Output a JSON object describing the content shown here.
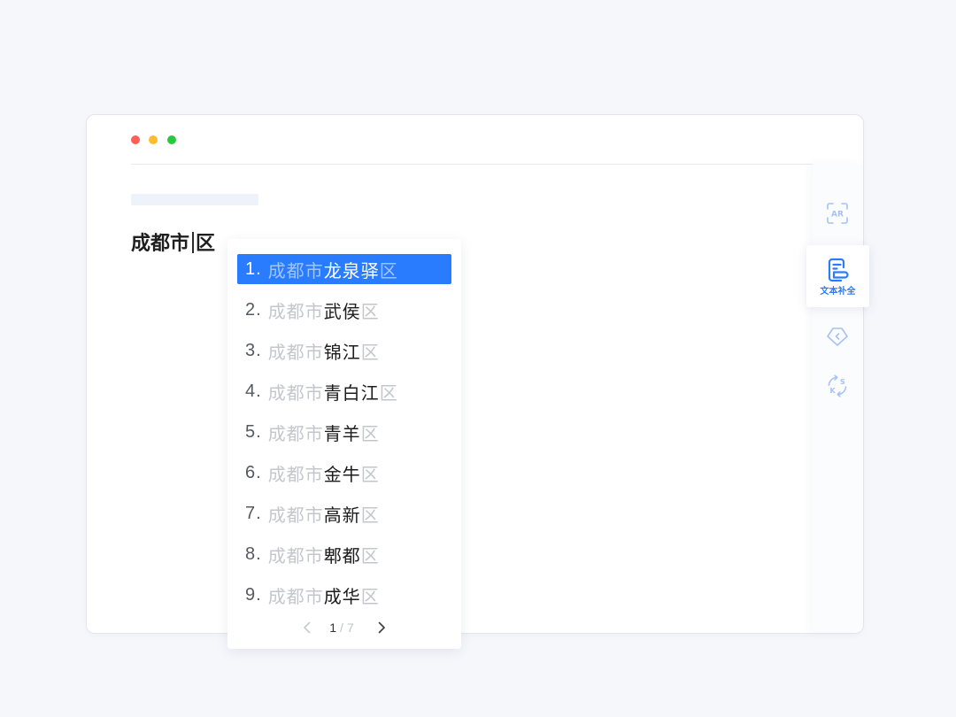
{
  "window": {
    "traffic_lights": {
      "close": "#ff5f57",
      "minimize": "#febc2e",
      "zoom": "#28c840"
    }
  },
  "editor": {
    "text_before_cursor": "成都市",
    "text_after_cursor": "区"
  },
  "suggestions": {
    "items": [
      {
        "index": "1.",
        "prefix": "成都市",
        "name": "龙泉驿",
        "suffix": "区",
        "selected": true
      },
      {
        "index": "2.",
        "prefix": "成都市",
        "name": "武侯",
        "suffix": "区",
        "selected": false
      },
      {
        "index": "3.",
        "prefix": "成都市",
        "name": "锦江",
        "suffix": "区",
        "selected": false
      },
      {
        "index": "4.",
        "prefix": "成都市",
        "name": "青白江",
        "suffix": "区",
        "selected": false
      },
      {
        "index": "5.",
        "prefix": "成都市",
        "name": "青羊",
        "suffix": "区",
        "selected": false
      },
      {
        "index": "6.",
        "prefix": "成都市",
        "name": "金牛",
        "suffix": "区",
        "selected": false
      },
      {
        "index": "7.",
        "prefix": "成都市",
        "name": "高新",
        "suffix": "区",
        "selected": false
      },
      {
        "index": "8.",
        "prefix": "成都市",
        "name": "郫都",
        "suffix": "区",
        "selected": false
      },
      {
        "index": "9.",
        "prefix": "成都市",
        "name": "成华",
        "suffix": "区",
        "selected": false
      }
    ],
    "pagination": {
      "current": "1",
      "separator": "/",
      "total": "7",
      "prev_icon": "chevron-left-icon",
      "next_icon": "chevron-right-icon"
    }
  },
  "sidebar": {
    "tools": [
      {
        "icon": "text-recognition-icon",
        "glyph": "AR",
        "active": false
      },
      {
        "icon": "text-completion-icon",
        "label": "文本补全",
        "active": true
      },
      {
        "icon": "tag-icon",
        "active": false
      },
      {
        "icon": "convert-icon",
        "glyphs": [
          "S",
          "K"
        ],
        "active": false
      }
    ]
  },
  "colors": {
    "page_background": "#f5f7fb",
    "accent": "#2a7cff",
    "icon_inactive": "#a6c2f5",
    "text_muted": "#c3c7cd"
  }
}
